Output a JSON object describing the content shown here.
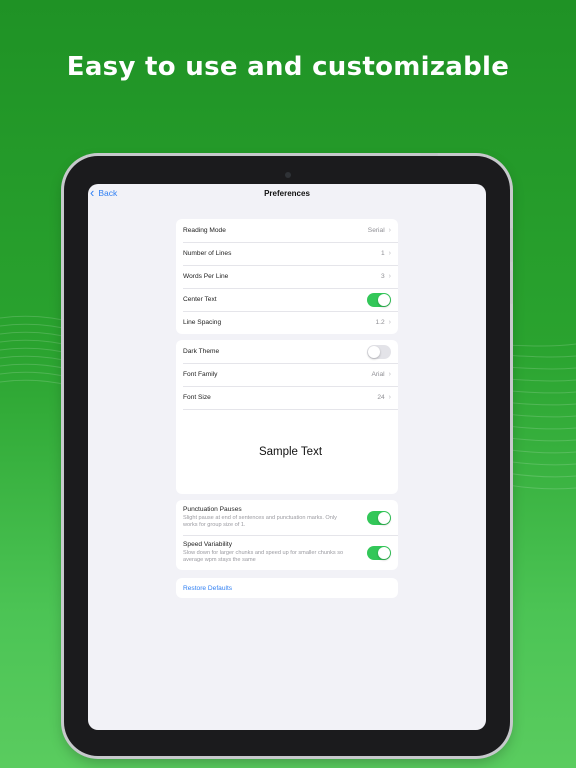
{
  "headline": "Easy to use and customizable",
  "nav": {
    "back_label": "Back",
    "title": "Preferences"
  },
  "groups": {
    "reading": [
      {
        "label": "Reading Mode",
        "value": "Serial"
      },
      {
        "label": "Number of Lines",
        "value": "1"
      },
      {
        "label": "Words Per Line",
        "value": "3"
      },
      {
        "label": "Center Text",
        "toggle": true
      },
      {
        "label": "Line Spacing",
        "value": "1.2"
      }
    ],
    "appearance": [
      {
        "label": "Dark Theme",
        "toggle": false
      },
      {
        "label": "Font Family",
        "value": "Arial"
      },
      {
        "label": "Font Size",
        "value": "24"
      }
    ],
    "sample_text": "Sample Text",
    "pauses": [
      {
        "label": "Punctuation Pauses",
        "description": "Slight pause at end of sentences and punctuation marks. Only works for group size of 1.",
        "toggle": true
      },
      {
        "label": "Speed Variability",
        "description": "Slow down for larger chunks and speed up for smaller chunks so average wpm stays the same",
        "toggle": true
      }
    ],
    "restore_label": "Restore Defaults"
  },
  "colors": {
    "background": "#2aa32f",
    "accent": "#2f7ff3",
    "toggle_on": "#33c759"
  }
}
